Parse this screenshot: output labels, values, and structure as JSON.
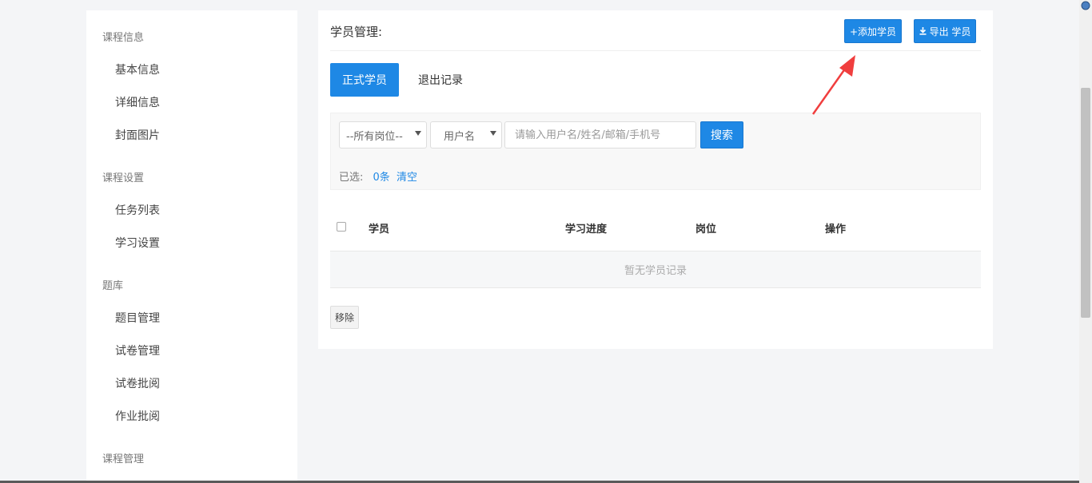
{
  "sidebar": {
    "groups": [
      {
        "title": "课程信息",
        "items": [
          "基本信息",
          "详细信息",
          "封面图片"
        ]
      },
      {
        "title": "课程设置",
        "items": [
          "任务列表",
          "学习设置"
        ]
      },
      {
        "title": "题库",
        "items": [
          "题目管理",
          "试卷管理",
          "试卷批阅",
          "作业批阅"
        ]
      },
      {
        "title": "课程管理",
        "items": []
      }
    ]
  },
  "panel": {
    "title": "学员管理:",
    "add_button": "+添加学员",
    "export_button": "导出 学员",
    "export_icon": "download-icon"
  },
  "tabs": {
    "active": "正式学员",
    "other": "退出记录"
  },
  "filters": {
    "position_select": "--所有岗位--",
    "field_select": "用户名",
    "search_placeholder": "请输入用户名/姓名/邮箱/手机号",
    "search_button": "搜索",
    "selected_label": "已选:",
    "selected_count": "0条",
    "clear_link": "清空"
  },
  "table": {
    "headers": [
      "学员",
      "学习进度",
      "岗位",
      "操作"
    ],
    "empty_text": "暂无学员记录"
  },
  "actions": {
    "remove_button": "移除"
  },
  "colors": {
    "accent": "#1e88e5",
    "annotation_arrow": "#f03e3e"
  }
}
